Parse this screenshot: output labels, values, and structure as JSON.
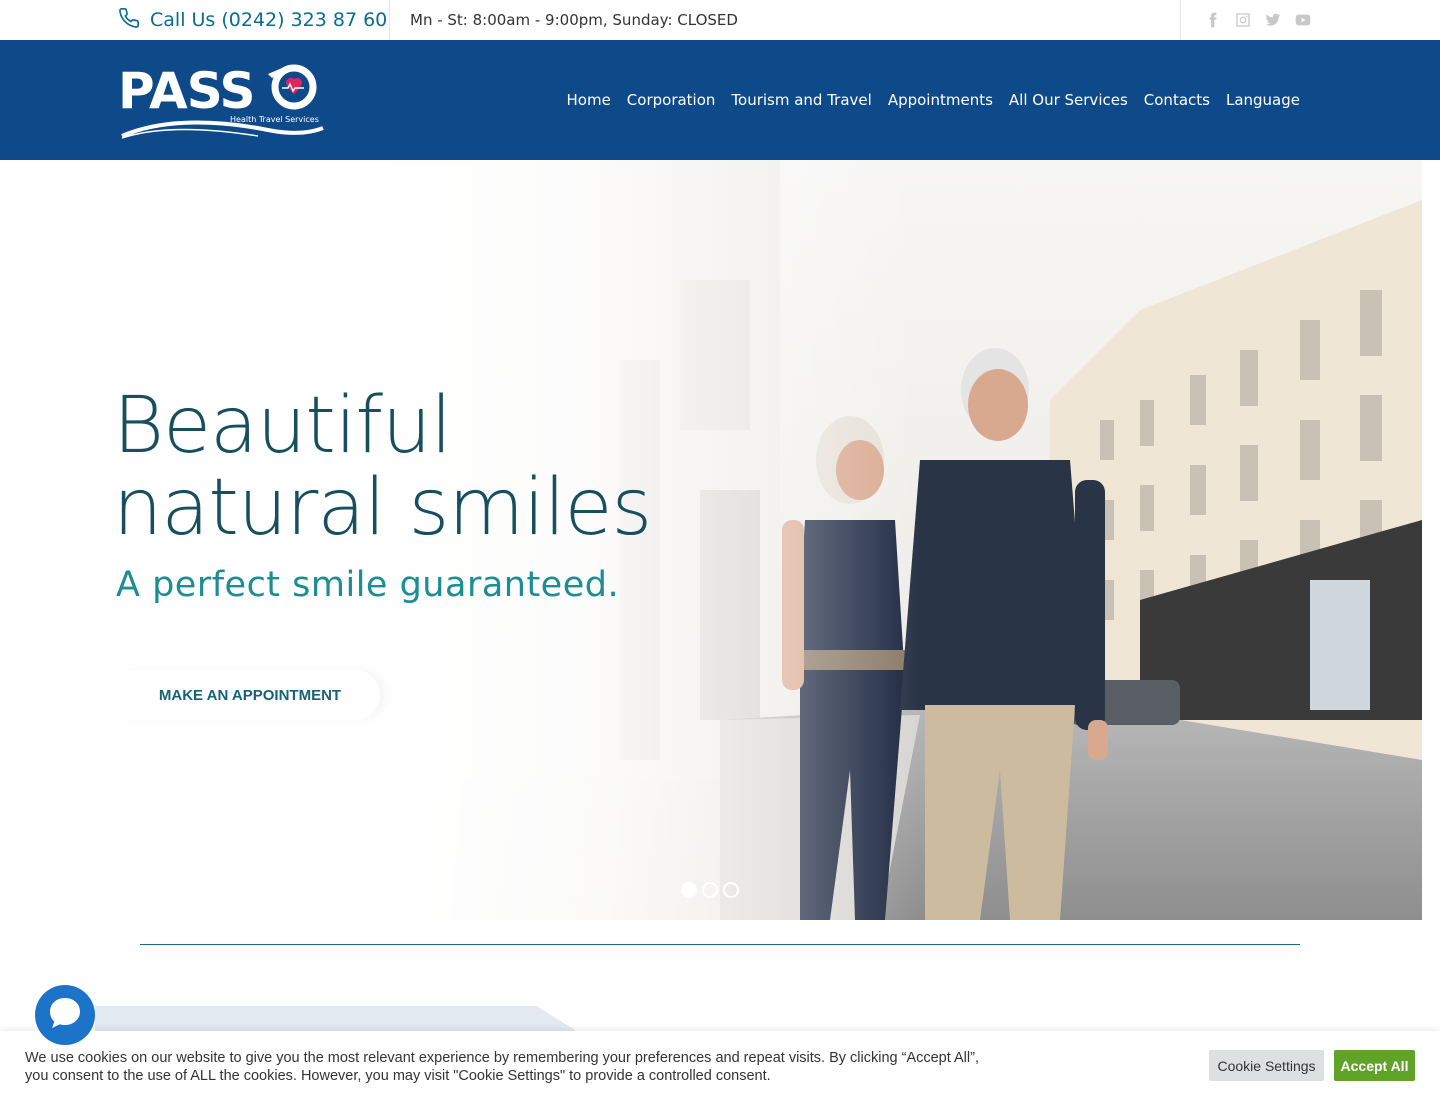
{
  "topbar": {
    "phone_label": "Call Us (0242) 323 87 60",
    "hours": "Mn - St: 8:00am - 9:00pm, Sunday: CLOSED",
    "social_icons": [
      "facebook-icon",
      "instagram-icon",
      "twitter-icon",
      "youtube-icon"
    ]
  },
  "header": {
    "logo_text": "PASSO",
    "logo_tagline": "Health Travel Services",
    "nav": [
      "Home",
      "Corporation",
      "Tourism and Travel",
      "Appointments",
      "All Our Services",
      "Contacts",
      "Language"
    ]
  },
  "hero": {
    "title_line1": "Beautiful",
    "title_line2": "natural smiles",
    "subtitle": "A perfect smile guaranteed.",
    "cta": "MAKE AN APPOINTMENT",
    "slides": 3,
    "active_slide": 1
  },
  "cookie": {
    "text_line1": "We use cookies on our website to give you the most relevant experience by remembering your preferences and repeat visits. By clicking “Accept All”,",
    "text_line2": "you consent to the use of ALL the cookies. However, you may visit \"Cookie Settings\" to provide a controlled consent.",
    "settings_label": "Cookie Settings",
    "accept_label": "Accept All"
  },
  "colors": {
    "header_bg": "#0e4a8a",
    "title": "#174f5e",
    "subtitle": "#1b8d93",
    "accept": "#61a229",
    "chat": "#1c74c8"
  }
}
